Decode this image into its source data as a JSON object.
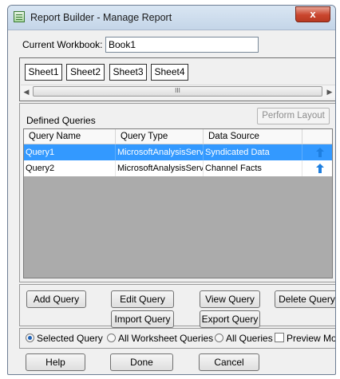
{
  "window": {
    "title": "Report Builder - Manage Report",
    "close_glyph": "x"
  },
  "workbook": {
    "label": "Current Workbook:",
    "value": "Book1"
  },
  "sheets": [
    "Sheet1",
    "Sheet2",
    "Sheet3",
    "Sheet4"
  ],
  "scrollbar": {
    "thumb_glyph": "III"
  },
  "queries": {
    "title": "Defined Queries",
    "perform_layout_label": "Perform Layout",
    "columns": [
      "Query Name",
      "Query Type",
      "Data Source",
      ""
    ],
    "rows": [
      {
        "name": "Query1",
        "type": "MicrosoftAnalysisServ...",
        "source": "Syndicated Data",
        "icon": "upload-arrow-icon",
        "selected": true
      },
      {
        "name": "Query2",
        "type": "MicrosoftAnalysisServ...",
        "source": "Channel Facts",
        "icon": "upload-arrow-icon",
        "selected": false
      }
    ]
  },
  "buttons": {
    "add_query": "Add Query",
    "edit_query": "Edit Query",
    "view_query": "View Query",
    "delete_query": "Delete Query",
    "import_query": "Import Query",
    "export_query": "Export Query"
  },
  "scope": {
    "selected_query": "Selected Query",
    "all_worksheet_queries": "All Worksheet Queries",
    "all_queries": "All Queries",
    "preview_mode": "Preview Mode",
    "checked": "selected_query",
    "preview_checked": false
  },
  "footer": {
    "help": "Help",
    "done": "Done",
    "cancel": "Cancel"
  },
  "colors": {
    "selection": "#3399ff",
    "arrow_icon": "#1e7fe0",
    "close_button": "#c9452d"
  }
}
